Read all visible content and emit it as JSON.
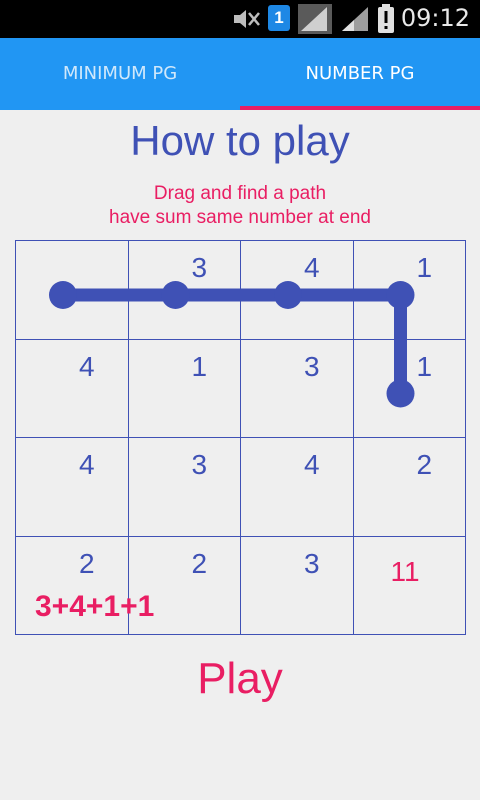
{
  "status_bar": {
    "time": "09:12",
    "sim_badge": "1",
    "icons": [
      "mute-icon",
      "sim-badge-icon",
      "signal-icon",
      "signal-icon",
      "battery-alert-icon"
    ]
  },
  "tabs": [
    {
      "label": "MINIMUM PG",
      "active": false
    },
    {
      "label": "NUMBER PG",
      "active": true
    }
  ],
  "title": "How to play",
  "instructions": [
    "Drag and find a path",
    "have sum same number at end"
  ],
  "grid": {
    "rows": [
      [
        "",
        "3",
        "4",
        "1"
      ],
      [
        "4",
        "1",
        "3",
        "1"
      ],
      [
        "4",
        "3",
        "4",
        "2"
      ],
      [
        "2",
        "2",
        "3",
        ""
      ]
    ],
    "target": "11",
    "equation": "3+4+1+1",
    "path_cells": [
      [
        0,
        0
      ],
      [
        0,
        1
      ],
      [
        0,
        2
      ],
      [
        0,
        3
      ],
      [
        1,
        3
      ]
    ]
  },
  "play_label": "Play",
  "colors": {
    "accent_blue": "#2196f3",
    "indigo": "#3f51b5",
    "pink": "#e91e63",
    "background": "#efefef"
  }
}
